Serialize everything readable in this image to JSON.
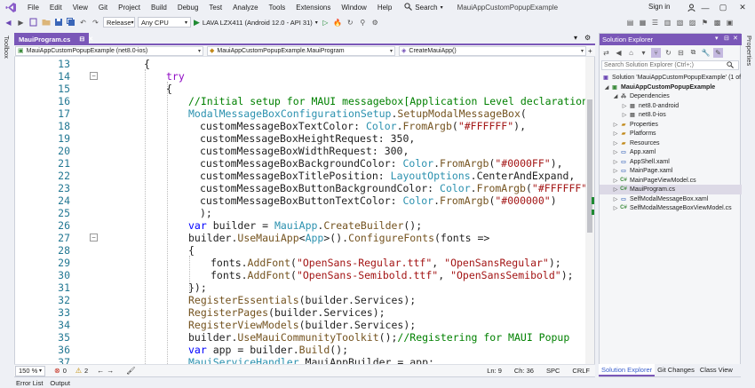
{
  "menubar": {
    "items": [
      "File",
      "Edit",
      "View",
      "Git",
      "Project",
      "Build",
      "Debug",
      "Test",
      "Analyze",
      "Tools",
      "Extensions",
      "Window",
      "Help"
    ],
    "search_label": "Search",
    "window_title": "MauiAppCustomPopupExample",
    "signin": "Sign in"
  },
  "toolbar": {
    "configuration": "Release",
    "platform": "Any CPU",
    "run_target": "LAVA LZX411 (Android 12.0 - API 31)"
  },
  "side": {
    "left_tool": "Toolbox",
    "right_tool": "Properties"
  },
  "editor": {
    "tab_label": "MauiProgram.cs",
    "nav_project": "MauiAppCustomPopupExample (net8.0-ios)",
    "nav_class": "MauiAppCustomPopupExample.MauiProgram",
    "nav_member": "CreateMauiApp()",
    "line_numbers": [
      "13",
      "14",
      "15",
      "16",
      "17",
      "18",
      "19",
      "20",
      "21",
      "22",
      "23",
      "24",
      "25",
      "26",
      "27",
      "28",
      "29",
      "30",
      "31",
      "32",
      "33",
      "34",
      "35",
      "36",
      "37"
    ],
    "zoom": "150 %",
    "errors": "0",
    "warnings": "2",
    "ln": "Ln: 9",
    "ch": "Ch: 36",
    "spc": "SPC",
    "crlf": "CRLF"
  },
  "solution_explorer": {
    "title": "Solution Explorer",
    "search_placeholder": "Search Solution Explorer (Ctrl+;)",
    "items": [
      {
        "label": "Solution 'MauiAppCustomPopupExample' (1 of",
        "icon": "solution-icon"
      },
      {
        "label": "MauiAppCustomPopupExample",
        "icon": "project-icon"
      },
      {
        "label": "Dependencies",
        "icon": "dependencies-icon"
      },
      {
        "label": "net8.0-android",
        "icon": "framework-icon"
      },
      {
        "label": "net8.0-ios",
        "icon": "framework-icon"
      },
      {
        "label": "Properties",
        "icon": "folder-icon"
      },
      {
        "label": "Platforms",
        "icon": "folder-icon"
      },
      {
        "label": "Resources",
        "icon": "folder-icon"
      },
      {
        "label": "App.xaml",
        "icon": "xaml-icon"
      },
      {
        "label": "AppShell.xaml",
        "icon": "xaml-icon"
      },
      {
        "label": "MainPage.xaml",
        "icon": "xaml-icon"
      },
      {
        "label": "MainPageViewModel.cs",
        "icon": "csharp-icon"
      },
      {
        "label": "MauiProgram.cs",
        "icon": "csharp-icon"
      },
      {
        "label": "SelfModalMessageBox.xaml",
        "icon": "xaml-icon"
      },
      {
        "label": "SelfModalMessageBoxViewModel.cs",
        "icon": "csharp-icon"
      }
    ],
    "tabs": [
      "Solution Explorer",
      "Git Changes",
      "Class View"
    ]
  },
  "bottom_tabs": [
    "Error List",
    "Output"
  ],
  "colors": {
    "accent": "#7a57b8",
    "keyword": "#0000ff",
    "control_keyword": "#8f08c4",
    "type": "#2b91af",
    "string": "#a31515",
    "comment": "#008000",
    "method": "#74531f"
  }
}
